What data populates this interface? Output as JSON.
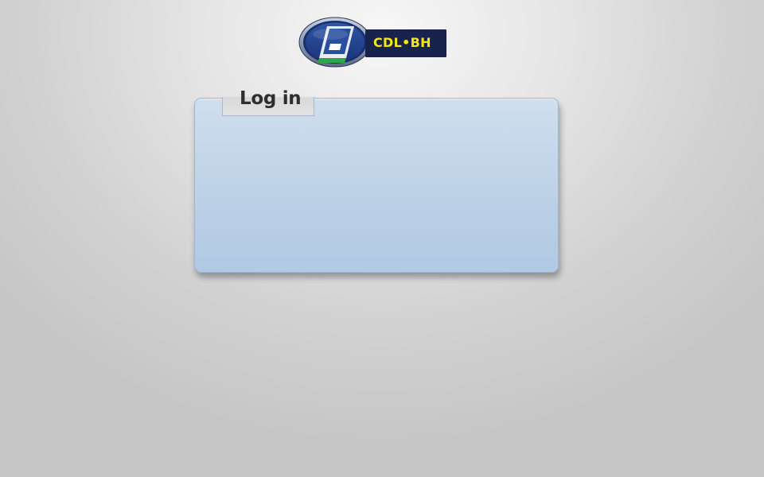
{
  "logo": {
    "text": "CDL•BH",
    "brand_colors": {
      "plate": "#17224d",
      "text": "#f5e61a",
      "emblem_blue": "#1e3f8f",
      "emblem_green": "#2fa64a"
    }
  },
  "login": {
    "title": "Log in"
  }
}
